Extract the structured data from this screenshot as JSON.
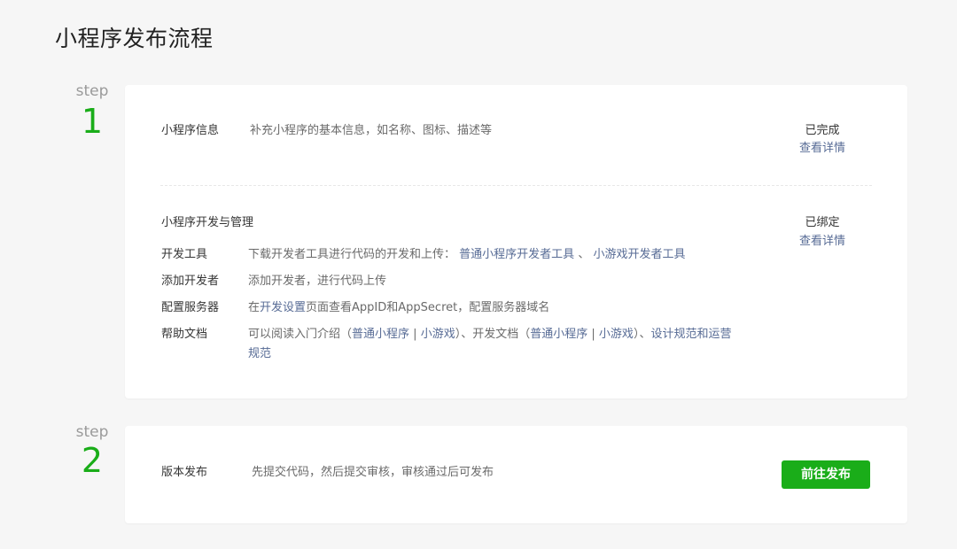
{
  "page_title": "小程序发布流程",
  "steps": [
    {
      "label": "step",
      "number": "1",
      "sections": {
        "info": {
          "title": "小程序信息",
          "description": "补充小程序的基本信息，如名称、图标、描述等",
          "status": "已完成",
          "detail_link": "查看详情"
        },
        "dev": {
          "title": "小程序开发与管理",
          "status": "已绑定",
          "detail_link": "查看详情",
          "rows": {
            "tools": {
              "label": "开发工具",
              "text": "下载开发者工具进行代码的开发和上传：",
              "link1": "普通小程序开发者工具",
              "sep": "、",
              "link2": "小游戏开发者工具"
            },
            "developers": {
              "label": "添加开发者",
              "text": "添加开发者，进行代码上传"
            },
            "server": {
              "label": "配置服务器",
              "prefix": "在",
              "link": "开发设置",
              "suffix": "页面查看AppID和AppSecret，配置服务器域名"
            },
            "docs": {
              "label": "帮助文档",
              "text1": "可以阅读入门介绍（",
              "link1": "普通小程序",
              "bar1": "|",
              "link2": "小游戏",
              "text2": "）、开发文档（",
              "link3": "普通小程序",
              "bar2": "|",
              "link4": "小游戏",
              "text3": "）、",
              "link5": "设计规范和运营",
              "link5b": "规范"
            }
          }
        }
      }
    },
    {
      "label": "step",
      "number": "2",
      "title": "版本发布",
      "description": "先提交代码，然后提交审核，审核通过后可发布",
      "button": "前往发布"
    }
  ],
  "colors": {
    "accent_green": "#1aad19",
    "link_blue": "#576b95",
    "background": "#f6f6f6"
  }
}
